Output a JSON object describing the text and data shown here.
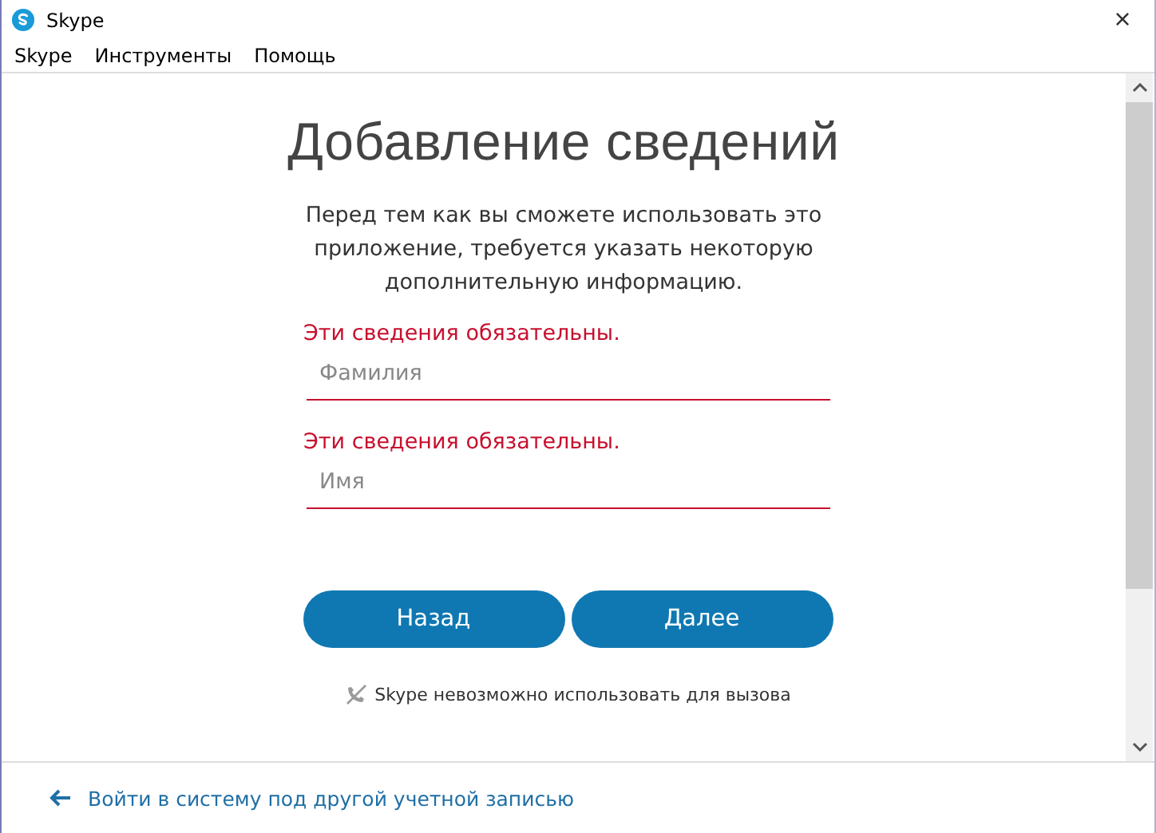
{
  "window": {
    "title": "Skype",
    "close": "×"
  },
  "menu": [
    "Skype",
    "Инструменты",
    "Помощь"
  ],
  "heading": "Добавление сведений",
  "intro": "Перед тем как вы сможете использовать это приложение, требуется указать некоторую дополнительную информацию.",
  "fields": [
    {
      "error": "Эти сведения обязательны.",
      "placeholder": "Фамилия"
    },
    {
      "error": "Эти сведения обязательны.",
      "placeholder": "Имя"
    }
  ],
  "buttons": [
    "Назад",
    "Далее"
  ],
  "notice": "Skype невозможно использовать для вызова",
  "footer_link": "Войти в систему под другой учетной записью"
}
